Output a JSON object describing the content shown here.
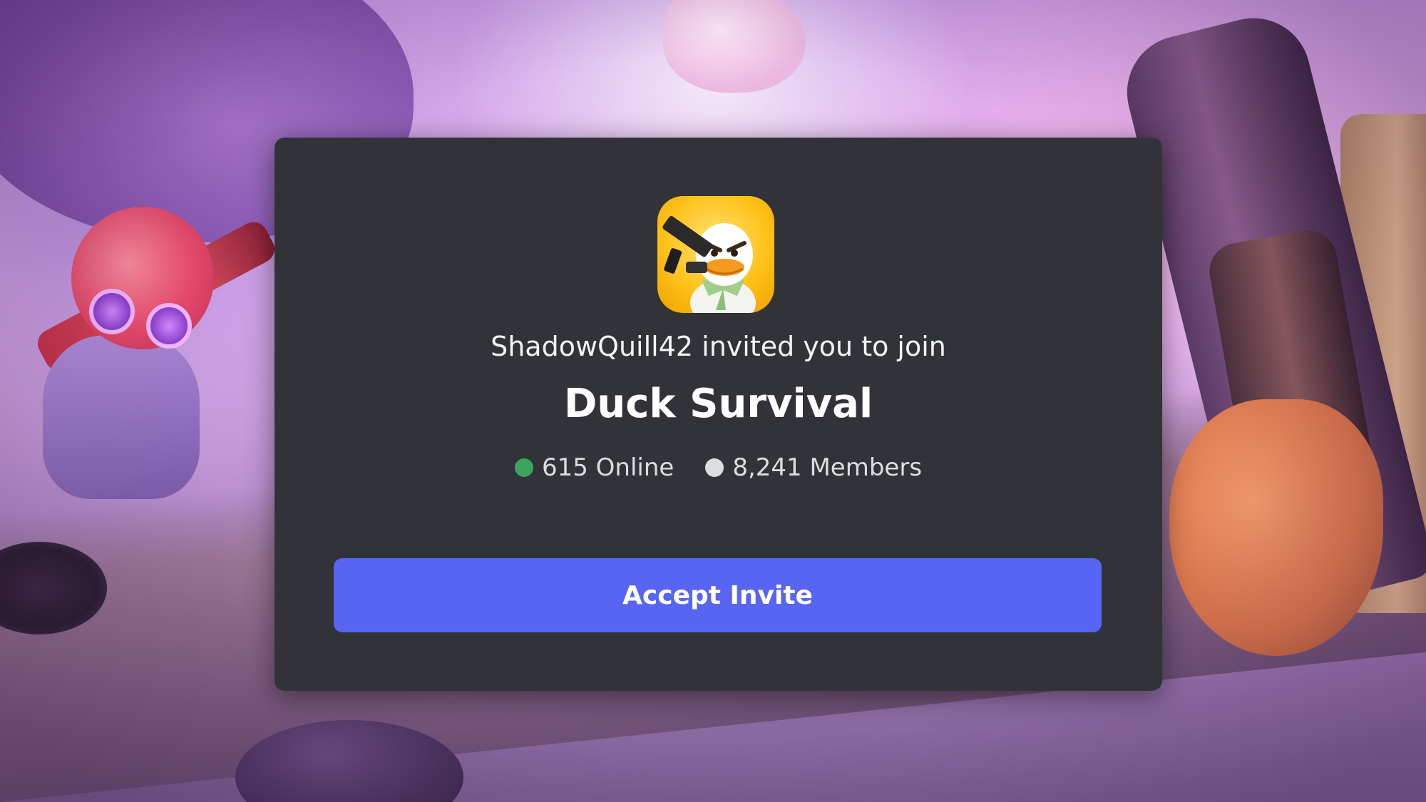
{
  "invite": {
    "inviter_text": "ShadowQuill42 invited you to join",
    "server_name": "Duck Survival",
    "server_icon": "duck-soldier-server-icon",
    "stats": {
      "online_label": "615 Online",
      "members_label": "8,241 Members",
      "online_color": "#3ba55c",
      "members_color": "#dbdee1"
    },
    "accept_button_label": "Accept Invite",
    "accent_color": "#5865f2",
    "card_color": "#313338"
  }
}
